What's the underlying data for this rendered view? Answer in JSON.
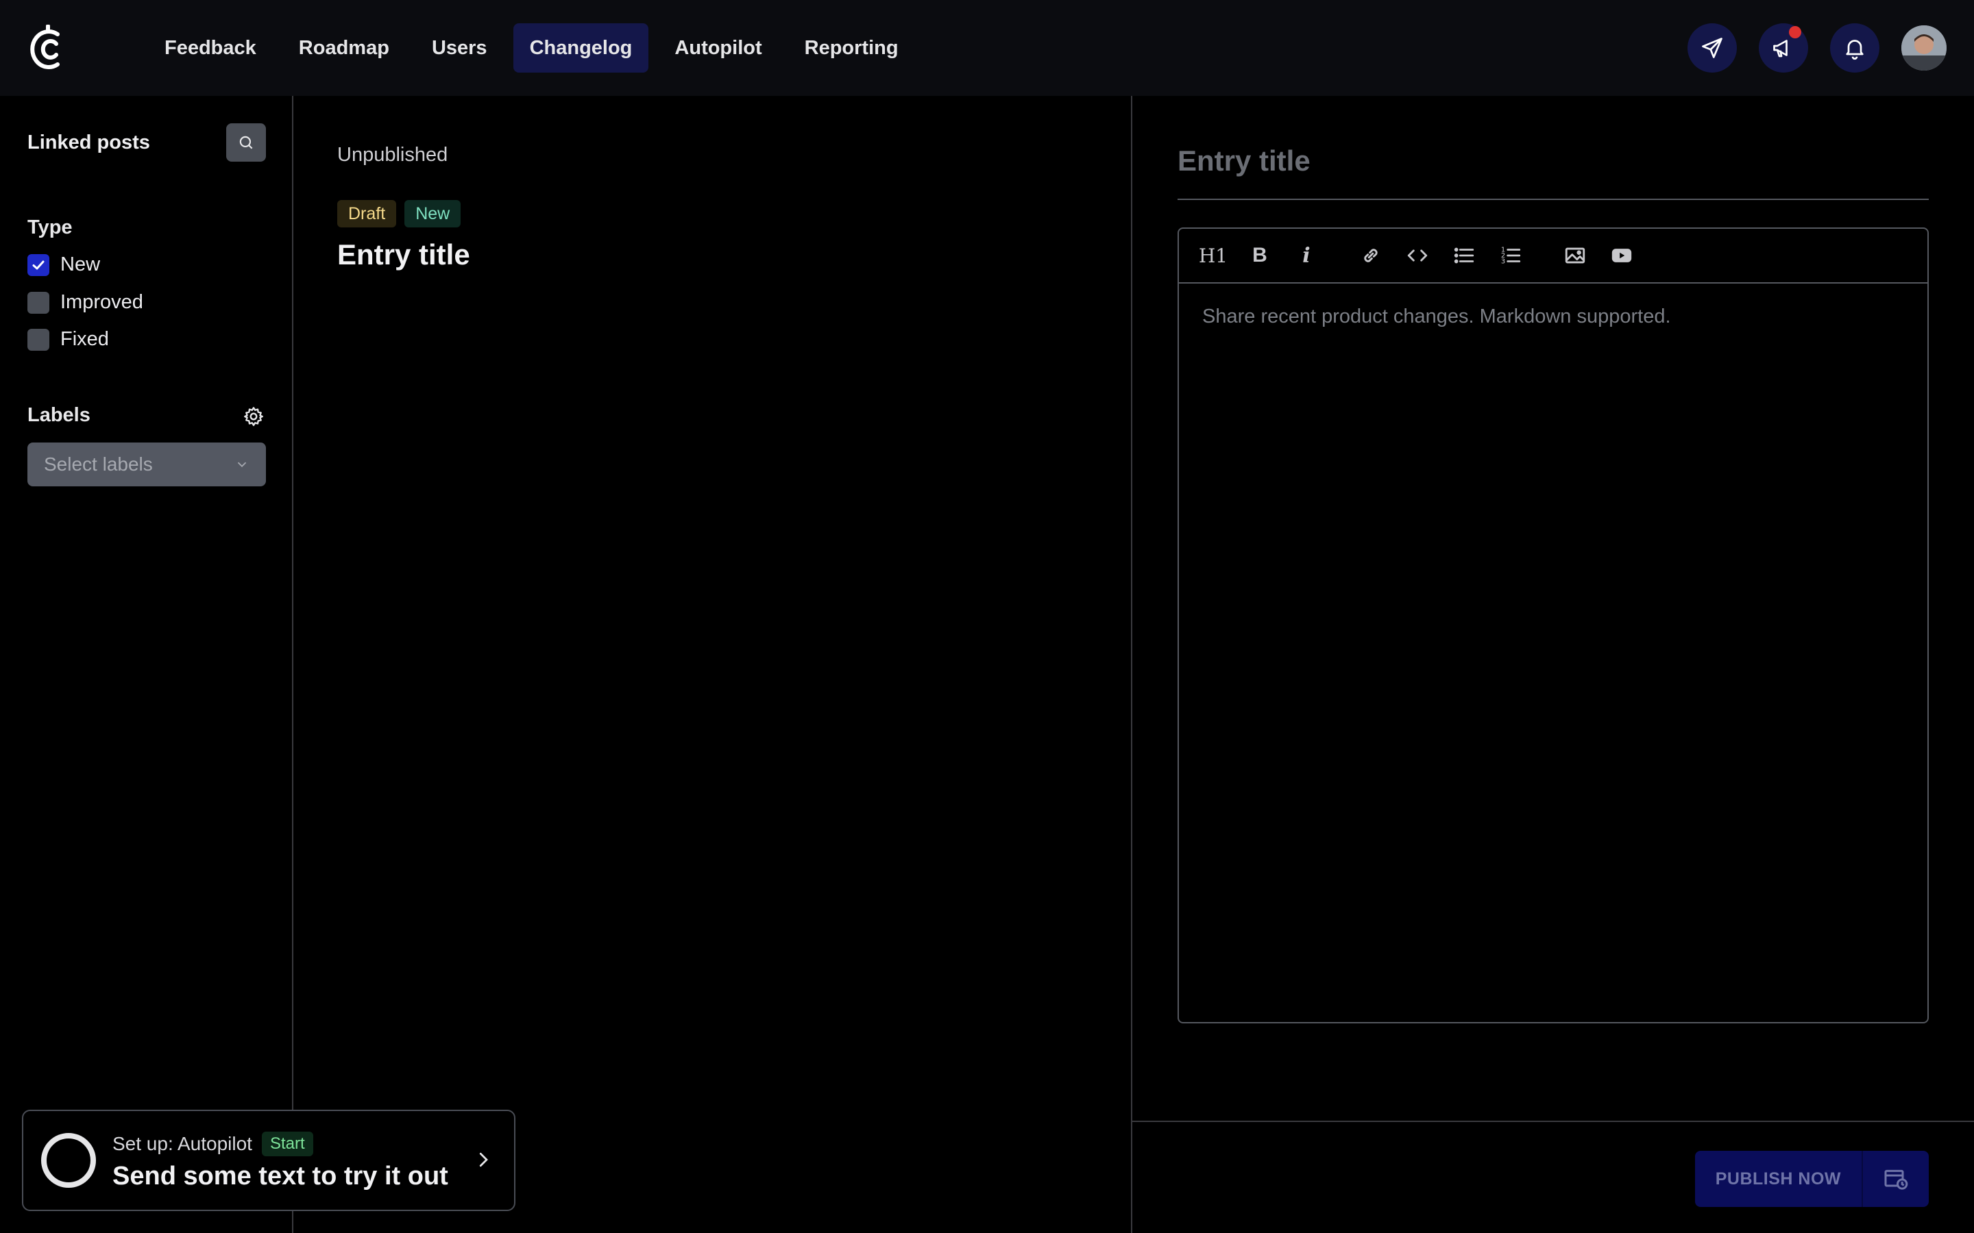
{
  "nav": {
    "items": [
      {
        "label": "Feedback",
        "active": false
      },
      {
        "label": "Roadmap",
        "active": false
      },
      {
        "label": "Users",
        "active": false
      },
      {
        "label": "Changelog",
        "active": true
      },
      {
        "label": "Autopilot",
        "active": false
      },
      {
        "label": "Reporting",
        "active": false
      }
    ]
  },
  "sidebar": {
    "linked_posts": "Linked posts",
    "type_heading": "Type",
    "types": [
      {
        "label": "New",
        "checked": true
      },
      {
        "label": "Improved",
        "checked": false
      },
      {
        "label": "Fixed",
        "checked": false
      }
    ],
    "labels_heading": "Labels",
    "labels_placeholder": "Select labels"
  },
  "preview": {
    "status": "Unpublished",
    "badge_draft": "Draft",
    "badge_new": "New",
    "title": "Entry title"
  },
  "editor": {
    "title_placeholder": "Entry title",
    "body_placeholder": "Share recent product changes. Markdown supported.",
    "toolbar": [
      "H1",
      "B",
      "i",
      "link-icon",
      "code-icon",
      "bullet-list-icon",
      "numbered-list-icon",
      "image-icon",
      "video-icon"
    ],
    "publish_label": "PUBLISH NOW"
  },
  "setup": {
    "line1": "Set up: Autopilot",
    "badge": "Start",
    "line2": "Send some text to try it out"
  },
  "colors": {
    "accent": "#14174a",
    "background": "#000000",
    "notification": "#e0312f"
  }
}
